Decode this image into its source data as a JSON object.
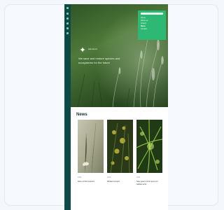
{
  "site": {
    "logo_text": "Life Fund",
    "tagline": "We save and restore species and ecosystems for the future",
    "nav_items": [
      "Home",
      "About us",
      "Grants",
      "News",
      "Contact"
    ],
    "active_nav": "News"
  },
  "news": {
    "section_title": "News",
    "items": [
      {
        "date": "2024",
        "title": "Rare orchid restored"
      },
      {
        "date": "2024",
        "title": "Wetland project"
      },
      {
        "date": "2024",
        "title": "New grant round opens for habitat work"
      }
    ]
  },
  "colors": {
    "rail": "#0d4a45",
    "accent": "#2db874",
    "hero_base": "#3d6a2f"
  }
}
